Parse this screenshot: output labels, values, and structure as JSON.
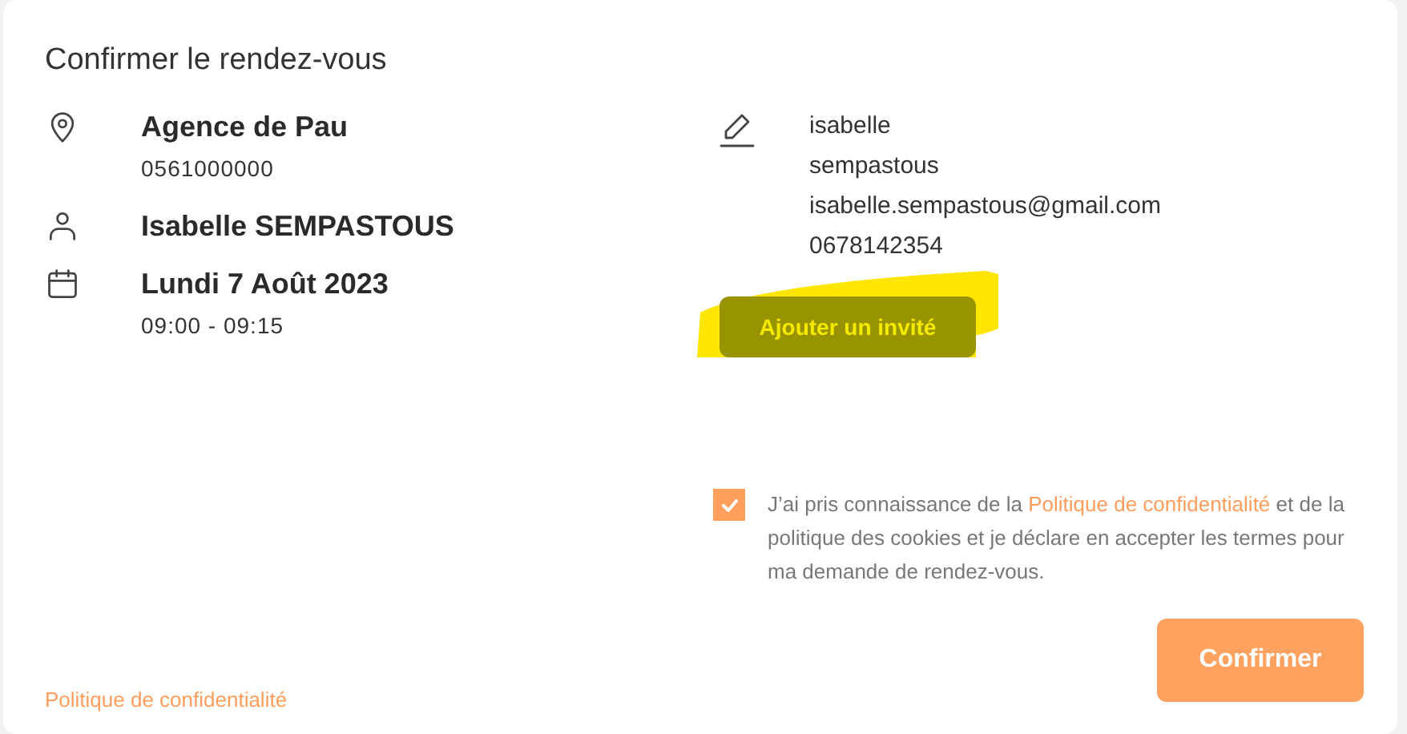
{
  "title": "Confirmer le rendez-vous",
  "details": [
    {
      "kind": "location",
      "title": "Agence de Pau",
      "subtitle": "0561000000"
    },
    {
      "kind": "person",
      "title": "Isabelle SEMPASTOUS"
    },
    {
      "kind": "date",
      "title": "Lundi 7 Août 2023",
      "subtitle": "09:00 - 09:15"
    }
  ],
  "contact": [
    "isabelle",
    "sempastous",
    "isabelle.sempastous@gmail.com",
    "0678142354"
  ],
  "add_guest_button": "Ajouter un invité",
  "consent": {
    "checked": true,
    "before": "J’ai pris connaissance de la",
    "link": "Politique de confidentialité",
    "after": "et de la politique des cookies et je déclare en accepter les termes pour ma demande de rendez-vous."
  },
  "footer_link": "Politique de confidentialité",
  "confirm_button": "Confirmer"
}
